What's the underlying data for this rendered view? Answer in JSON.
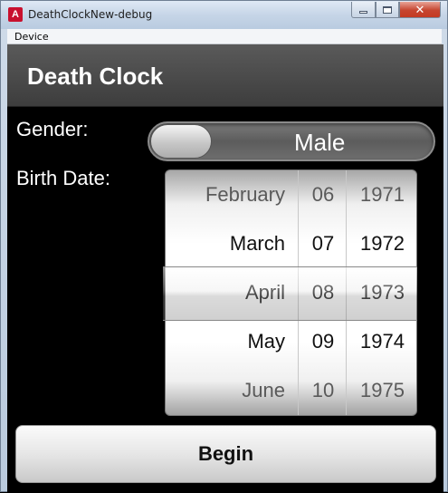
{
  "window": {
    "title": "DeathClockNew-debug",
    "icon": "adobe-air-icon"
  },
  "menu": {
    "items": [
      "Device"
    ]
  },
  "app": {
    "title": "Death Clock"
  },
  "form": {
    "gender_label": "Gender:",
    "gender_value": "Male",
    "birth_label": "Birth Date:"
  },
  "date_spinner": {
    "months": [
      "February",
      "March",
      "April",
      "May",
      "June"
    ],
    "days": [
      "06",
      "07",
      "08",
      "09",
      "10"
    ],
    "years": [
      "1971",
      "1972",
      "1973",
      "1974",
      "1975"
    ],
    "selected": {
      "month": "April",
      "day": "08",
      "year": "1973"
    }
  },
  "actions": {
    "begin_label": "Begin"
  },
  "colors": {
    "background": "#000000",
    "header": "#4a4a4a",
    "close_button": "#c6452f"
  }
}
